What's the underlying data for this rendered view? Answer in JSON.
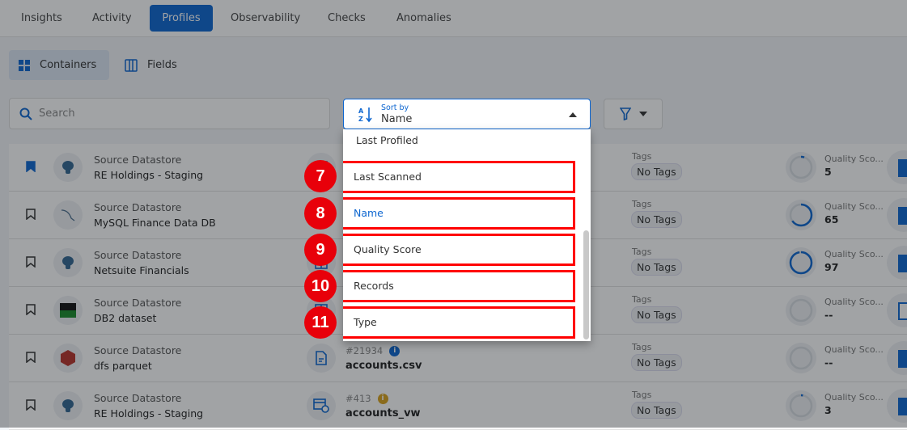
{
  "tabs": [
    {
      "label": "Insights"
    },
    {
      "label": "Activity"
    },
    {
      "label": "Profiles",
      "active": true
    },
    {
      "label": "Observability"
    },
    {
      "label": "Checks"
    },
    {
      "label": "Anomalies"
    }
  ],
  "views": {
    "containers": "Containers",
    "fields": "Fields"
  },
  "search": {
    "placeholder": "Search"
  },
  "sort": {
    "label": "Sort by",
    "value": "Name",
    "options": [
      "Last Profiled",
      "Last Scanned",
      "Name",
      "Quality Score",
      "Records",
      "Type"
    ],
    "selected": "Name"
  },
  "annotations": [
    "7",
    "8",
    "9",
    "10",
    "11"
  ],
  "colors": {
    "accent": "#0d66d0",
    "annotation": "#e8000a"
  },
  "rows": [
    {
      "source": "Source Datastore",
      "name": "RE Holdings - Staging",
      "bookmarked": true,
      "icon": "postgres-icon",
      "tags_label": "Tags",
      "tags": "No Tags",
      "quality_label": "Quality Sco...",
      "quality": "5",
      "quality_pct": 5
    },
    {
      "source": "Source Datastore",
      "name": "MySQL Finance Data DB",
      "bookmarked": false,
      "icon": "mysql-icon",
      "tags_label": "Tags",
      "tags": "No Tags",
      "quality_label": "Quality Sco...",
      "quality": "65",
      "quality_pct": 65
    },
    {
      "source": "Source Datastore",
      "name": "Netsuite Financials",
      "bookmarked": false,
      "icon": "postgres-icon",
      "tags_label": "Tags",
      "tags": "No Tags",
      "quality_label": "Quality Sco...",
      "quality": "97",
      "quality_pct": 97
    },
    {
      "source": "Source Datastore",
      "name": "DB2 dataset",
      "bookmarked": false,
      "icon": "db2-icon",
      "tags_label": "Tags",
      "tags": "No Tags",
      "quality_label": "Quality Sco...",
      "quality": "--",
      "quality_pct": 0
    },
    {
      "source": "Source Datastore",
      "name": "dfs parquet",
      "bookmarked": false,
      "icon": "dfs-icon",
      "container_id": "#21934",
      "container_name": "accounts.csv",
      "tags_label": "Tags",
      "tags": "No Tags",
      "quality_label": "Quality Sco...",
      "quality": "--",
      "quality_pct": 0
    },
    {
      "source": "Source Datastore",
      "name": "RE Holdings - Staging",
      "bookmarked": false,
      "icon": "postgres-icon",
      "container_id": "#413",
      "container_name": "accounts_vw",
      "tags_label": "Tags",
      "tags": "No Tags",
      "quality_label": "Quality Sco...",
      "quality": "3",
      "quality_pct": 3
    }
  ]
}
